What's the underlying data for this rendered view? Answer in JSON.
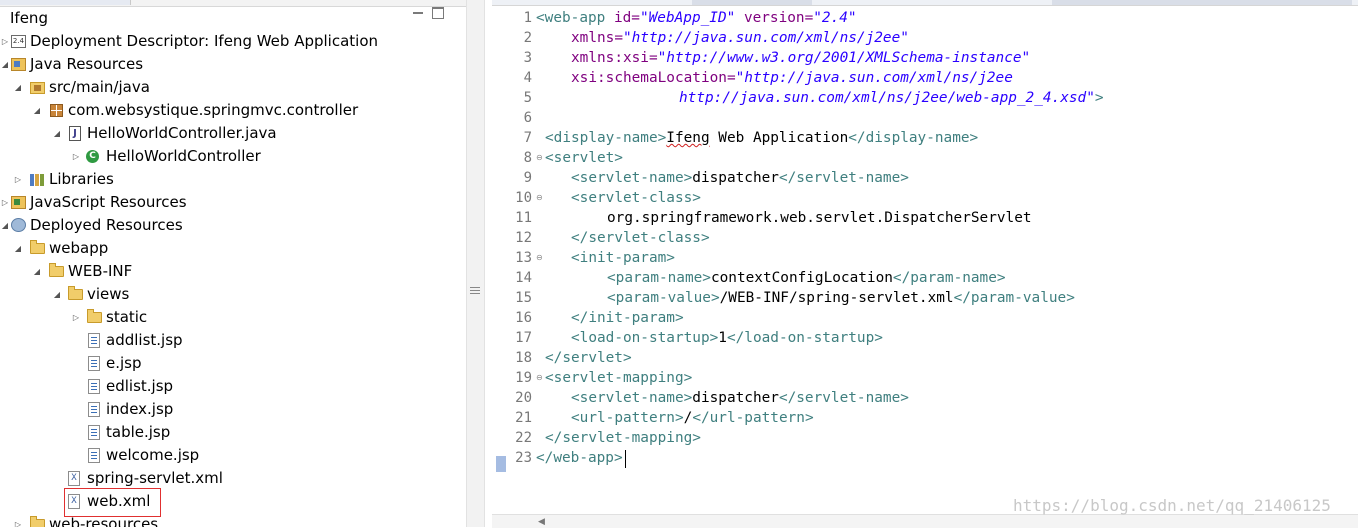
{
  "explorer": {
    "items": [
      {
        "label": "Ifeng",
        "icon": "folder-icon"
      },
      {
        "label": "Deployment Descriptor: Ifeng Web Application",
        "icon": "deployment-descriptor-icon"
      },
      {
        "label": "Java Resources",
        "icon": "java-resources-icon"
      },
      {
        "label": "src/main/java",
        "icon": "source-folder-icon"
      },
      {
        "label": "com.websystique.springmvc.controller",
        "icon": "package-icon"
      },
      {
        "label": "HelloWorldController.java",
        "icon": "java-file-icon"
      },
      {
        "label": "HelloWorldController",
        "icon": "class-icon"
      },
      {
        "label": "Libraries",
        "icon": "libraries-icon"
      },
      {
        "label": "JavaScript Resources",
        "icon": "javascript-resources-icon"
      },
      {
        "label": "Deployed Resources",
        "icon": "deployed-resources-icon"
      },
      {
        "label": "webapp",
        "icon": "folder-icon"
      },
      {
        "label": "WEB-INF",
        "icon": "folder-icon"
      },
      {
        "label": "views",
        "icon": "folder-icon"
      },
      {
        "label": "static",
        "icon": "folder-icon"
      },
      {
        "label": "addlist.jsp",
        "icon": "jsp-file-icon"
      },
      {
        "label": "e.jsp",
        "icon": "jsp-file-icon"
      },
      {
        "label": "edlist.jsp",
        "icon": "jsp-file-icon"
      },
      {
        "label": "index.jsp",
        "icon": "jsp-file-icon"
      },
      {
        "label": "table.jsp",
        "icon": "jsp-file-icon"
      },
      {
        "label": "welcome.jsp",
        "icon": "jsp-file-icon"
      },
      {
        "label": "spring-servlet.xml",
        "icon": "xml-file-icon"
      },
      {
        "label": "web.xml",
        "icon": "xml-file-icon"
      },
      {
        "label": "web-resources",
        "icon": "folder-icon"
      }
    ]
  },
  "editor": {
    "line_numbers": [
      "1",
      "2",
      "3",
      "4",
      "5",
      "6",
      "7",
      "8",
      "9",
      "10",
      "11",
      "12",
      "13",
      "14",
      "15",
      "16",
      "17",
      "18",
      "19",
      "20",
      "21",
      "22",
      "23"
    ],
    "code": {
      "l1": {
        "open": "<web-app",
        "a1": " id=",
        "v1": "\"WebApp_ID\"",
        "a2": " version=",
        "v2": "\"2.4\""
      },
      "l2": {
        "a": "xmlns=",
        "v": "\"http://java.sun.com/xml/ns/j2ee\""
      },
      "l3": {
        "a": "xmlns:xsi=",
        "v": "\"http://www.w3.org/2001/XMLSchema-instance\""
      },
      "l4": {
        "a": "xsi:schemaLocation=",
        "v": "\"http://java.sun.com/xml/ns/j2ee"
      },
      "l5": {
        "v": "http://java.sun.com/xml/ns/j2ee/web-app_2_4.xsd\"",
        "close": ">"
      },
      "l7": {
        "open": "<display-name>",
        "text1": "Ifeng",
        "text2": " Web Application",
        "close": "</display-name>"
      },
      "l8": {
        "open": "<servlet>"
      },
      "l9": {
        "open": "<servlet-name>",
        "text": "dispatcher",
        "close": "</servlet-name>"
      },
      "l10": {
        "open": "<servlet-class>"
      },
      "l11": {
        "text": "org.springframework.web.servlet.DispatcherServlet"
      },
      "l12": {
        "close": "</servlet-class>"
      },
      "l13": {
        "open": "<init-param>"
      },
      "l14": {
        "open": "<param-name>",
        "text": "contextConfigLocation",
        "close": "</param-name>"
      },
      "l15": {
        "open": "<param-value>",
        "text": "/WEB-INF/spring-servlet.xml",
        "close": "</param-value>"
      },
      "l16": {
        "close": "</init-param>"
      },
      "l17": {
        "open": "<load-on-startup>",
        "text": "1",
        "close": "</load-on-startup>"
      },
      "l18": {
        "close": "</servlet>"
      },
      "l19": {
        "open": "<servlet-mapping>"
      },
      "l20": {
        "open": "<servlet-name>",
        "text": "dispatcher",
        "close": "</servlet-name>"
      },
      "l21": {
        "open": "<url-pattern>",
        "text": "/",
        "close": "</url-pattern>"
      },
      "l22": {
        "close": "</servlet-mapping>"
      },
      "l23": {
        "close": "</web-app>"
      }
    }
  },
  "watermark": "https://blog.csdn.net/qq_21406125",
  "colors": {
    "tag": "#3f7f7f",
    "attr": "#7f007f",
    "value": "#2a00ff",
    "highlight_box": "#e03030"
  }
}
